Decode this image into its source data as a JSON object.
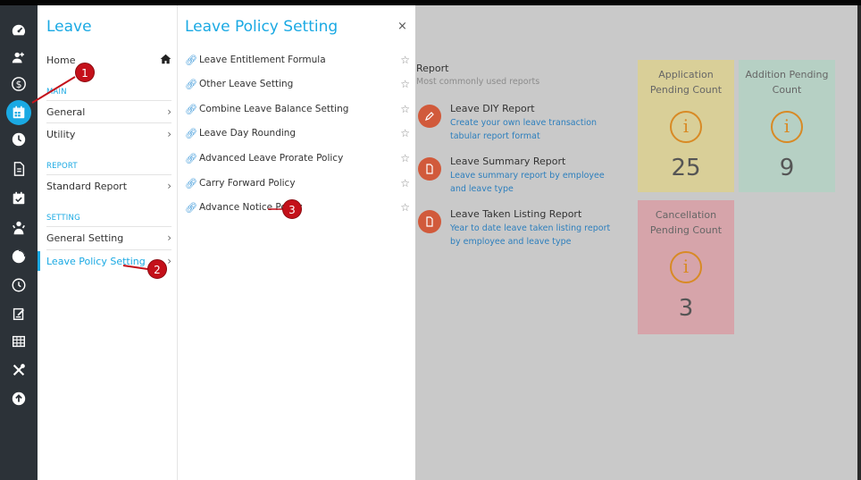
{
  "menu": {
    "title": "Leave",
    "home": "Home",
    "sections": {
      "main": "MAIN",
      "report": "REPORT",
      "setting": "SETTING"
    },
    "items": {
      "general": "General",
      "utility": "Utility",
      "standard_report": "Standard Report",
      "general_setting": "General Setting",
      "leave_policy_setting": "Leave Policy Setting"
    },
    "chevron": "›"
  },
  "submenu": {
    "title": "Leave Policy Setting",
    "close": "×",
    "items": [
      "Leave Entitlement Formula",
      "Other Leave Setting",
      "Combine Leave Balance Setting",
      "Leave Day Rounding",
      "Advanced Leave Prorate Policy",
      "Carry Forward Policy",
      "Advance Notice Policy"
    ],
    "star": "☆"
  },
  "dashboard": {
    "report_title": "Report",
    "report_subtitle": "Most commonly used reports",
    "reports": [
      {
        "name": "Leave DIY Report",
        "desc": "Create your own leave transaction tabular report format"
      },
      {
        "name": "Leave Summary Report",
        "desc": "Leave summary report by employee and leave type"
      },
      {
        "name": "Leave Taken Listing Report",
        "desc": "Year to date leave taken listing report by employee and leave type"
      }
    ],
    "cards": [
      {
        "title_1": "Application",
        "title_2": "Pending Count",
        "count": "25",
        "color": "#d9cf98"
      },
      {
        "title_1": "Addition Pending",
        "title_2": "Count",
        "count": "9",
        "color": "#b6d0c4"
      },
      {
        "title_1": "Cancellation",
        "title_2": "Pending Count",
        "count": "3",
        "color": "#d6a4aa"
      }
    ],
    "info_glyph": "i"
  },
  "annotations": [
    "1",
    "2",
    "3"
  ],
  "colors": {
    "accent": "#1aa9e3",
    "rail": "#2c3238",
    "report_icon": "#d15a3b",
    "annotation": "#c4101a"
  },
  "rail_icons": [
    "dashboard-icon",
    "users-icon",
    "dollar-icon",
    "calendar-icon",
    "clock-icon",
    "document-icon",
    "calendar-check-icon",
    "people-icon",
    "pie-chart-icon",
    "timer-icon",
    "edit-document-icon",
    "table-icon",
    "tools-icon",
    "upload-icon"
  ]
}
